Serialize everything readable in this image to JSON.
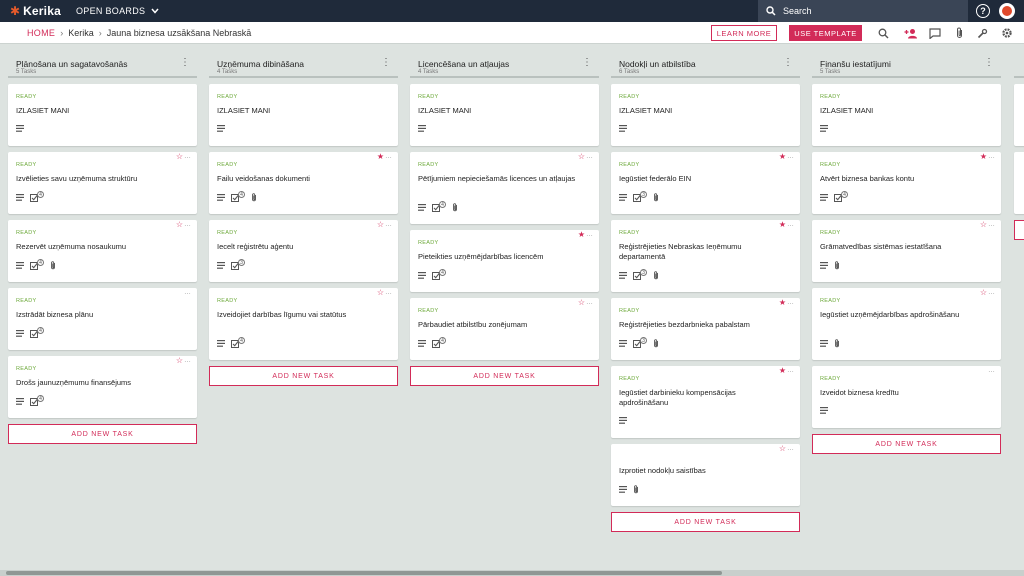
{
  "app": {
    "name": "Kerika"
  },
  "topbar": {
    "open_boards": "OPEN BOARDS",
    "search_label": "Search",
    "help_label": "?"
  },
  "breadcrumb": {
    "home": "HOME",
    "items": [
      "Kerika",
      "Jauna biznesa uzsākšana Nebraskā"
    ]
  },
  "toolbar": {
    "learn_more": "LEARN MORE",
    "use_template": "USE TEMPLATE"
  },
  "colors": {
    "accent": "#d22b58",
    "topbar": "#1f2a3a",
    "ready": "#6eaa3c",
    "board_bg": "#dde3e0",
    "logo": "#e55a2b"
  },
  "add_task_label": "ADD NEW TASK",
  "columns": [
    {
      "title": "Plānošana un sagatavošanās",
      "count": "5 Tasks",
      "cards": [
        {
          "status": "READY",
          "title": "IZLASIET MANI",
          "icons": [
            "notes-icon"
          ],
          "star": "",
          "more": false
        },
        {
          "status": "READY",
          "title": "Izvēlieties savu uzņēmuma struktūru",
          "icons": [
            "notes-icon",
            "checklist-icon"
          ],
          "badge": "4",
          "star": "☆",
          "more": true
        },
        {
          "status": "READY",
          "title": "Rezervēt uzņēmuma nosaukumu",
          "icons": [
            "notes-icon",
            "checklist-icon",
            "attachment-icon"
          ],
          "badge": "4",
          "star": "☆",
          "more": true
        },
        {
          "status": "READY",
          "title": "Izstrādāt biznesa plānu",
          "icons": [
            "notes-icon",
            "checklist-icon"
          ],
          "badge": "4",
          "star": "",
          "more": true
        },
        {
          "status": "READY",
          "title": "Drošs jaunuzņēmumu finansējums",
          "icons": [
            "notes-icon",
            "checklist-icon"
          ],
          "badge": "4",
          "star": "☆",
          "more": true
        }
      ]
    },
    {
      "title": "Uzņēmuma dibināšana",
      "count": "4 Tasks",
      "cards": [
        {
          "status": "READY",
          "title": "IZLASIET MANI",
          "icons": [
            "notes-icon"
          ],
          "star": "",
          "more": false
        },
        {
          "status": "READY",
          "title": "Failu veidošanas dokumenti",
          "icons": [
            "notes-icon",
            "checklist-icon",
            "attachment-icon"
          ],
          "badge": "4",
          "star": "★",
          "more": true
        },
        {
          "status": "READY",
          "title": "Iecelt reģistrētu aģentu",
          "icons": [
            "notes-icon",
            "checklist-icon"
          ],
          "badge": "3",
          "star": "☆",
          "more": true
        },
        {
          "status": "READY",
          "title": "Izveidojiet darbības līgumu vai statūtus",
          "icons": [
            "notes-icon",
            "checklist-icon"
          ],
          "badge": "4",
          "star": "☆",
          "more": true
        }
      ]
    },
    {
      "title": "Licencēšana un atļaujas",
      "count": "4 Tasks",
      "cards": [
        {
          "status": "READY",
          "title": "IZLASIET MANI",
          "icons": [
            "notes-icon"
          ],
          "star": "",
          "more": false
        },
        {
          "status": "READY",
          "title": "Pētījumiem nepieciešamās licences un atļaujas",
          "icons": [
            "notes-icon",
            "checklist-icon",
            "attachment-icon"
          ],
          "badge": "4",
          "star": "☆",
          "more": true
        },
        {
          "status": "READY",
          "title": "Pieteikties uzņēmējdarbības licencēm",
          "icons": [
            "notes-icon",
            "checklist-icon"
          ],
          "badge": "4",
          "star": "★",
          "more": true
        },
        {
          "status": "READY",
          "title": "Pārbaudiet atbilstību zonējumam",
          "icons": [
            "notes-icon",
            "checklist-icon"
          ],
          "badge": "4",
          "star": "☆",
          "more": true
        }
      ]
    },
    {
      "title": "Nodokļi un atbilstība",
      "count": "6 Tasks",
      "cards": [
        {
          "status": "READY",
          "title": "IZLASIET MANI",
          "icons": [
            "notes-icon"
          ],
          "star": "",
          "more": false
        },
        {
          "status": "READY",
          "title": "Iegūstiet federālo EIN",
          "icons": [
            "notes-icon",
            "checklist-icon",
            "attachment-icon"
          ],
          "badge": "3",
          "star": "★",
          "more": true
        },
        {
          "status": "READY",
          "title": "Reģistrējieties Nebraskas Ieņēmumu departamentā",
          "icons": [
            "notes-icon",
            "checklist-icon",
            "attachment-icon"
          ],
          "badge": "3",
          "star": "★",
          "more": true
        },
        {
          "status": "READY",
          "title": "Reģistrējieties bezdarbnieka pabalstam",
          "icons": [
            "notes-icon",
            "checklist-icon",
            "attachment-icon"
          ],
          "badge": "3",
          "star": "★",
          "more": true
        },
        {
          "status": "READY",
          "title": "Iegūstiet darbinieku kompensācijas apdrošināšanu",
          "icons": [
            "notes-icon"
          ],
          "star": "★",
          "more": true
        },
        {
          "status": "",
          "title": "Izprotiet nodokļu saistības",
          "icons": [
            "notes-icon",
            "attachment-icon"
          ],
          "star": "☆",
          "more": true
        }
      ]
    },
    {
      "title": "Finanšu iestatījumi",
      "count": "5 Tasks",
      "cards": [
        {
          "status": "READY",
          "title": "IZLASIET MANI",
          "icons": [
            "notes-icon"
          ],
          "star": "",
          "more": false
        },
        {
          "status": "READY",
          "title": "Atvērt biznesa bankas kontu",
          "icons": [
            "notes-icon",
            "checklist-icon"
          ],
          "badge": "4",
          "star": "★",
          "more": true
        },
        {
          "status": "READY",
          "title": "Grāmatvedības sistēmas iestatīšana",
          "icons": [
            "notes-icon",
            "attachment-icon"
          ],
          "star": "☆",
          "more": true
        },
        {
          "status": "READY",
          "title": "Iegūstiet uzņēmējdarbības apdrošināšanu",
          "icons": [
            "notes-icon",
            "attachment-icon"
          ],
          "star": "☆",
          "more": true
        },
        {
          "status": "READY",
          "title": "Izveidot biznesa kredītu",
          "icons": [
            "notes-icon"
          ],
          "star": "",
          "more": true
        }
      ]
    }
  ]
}
